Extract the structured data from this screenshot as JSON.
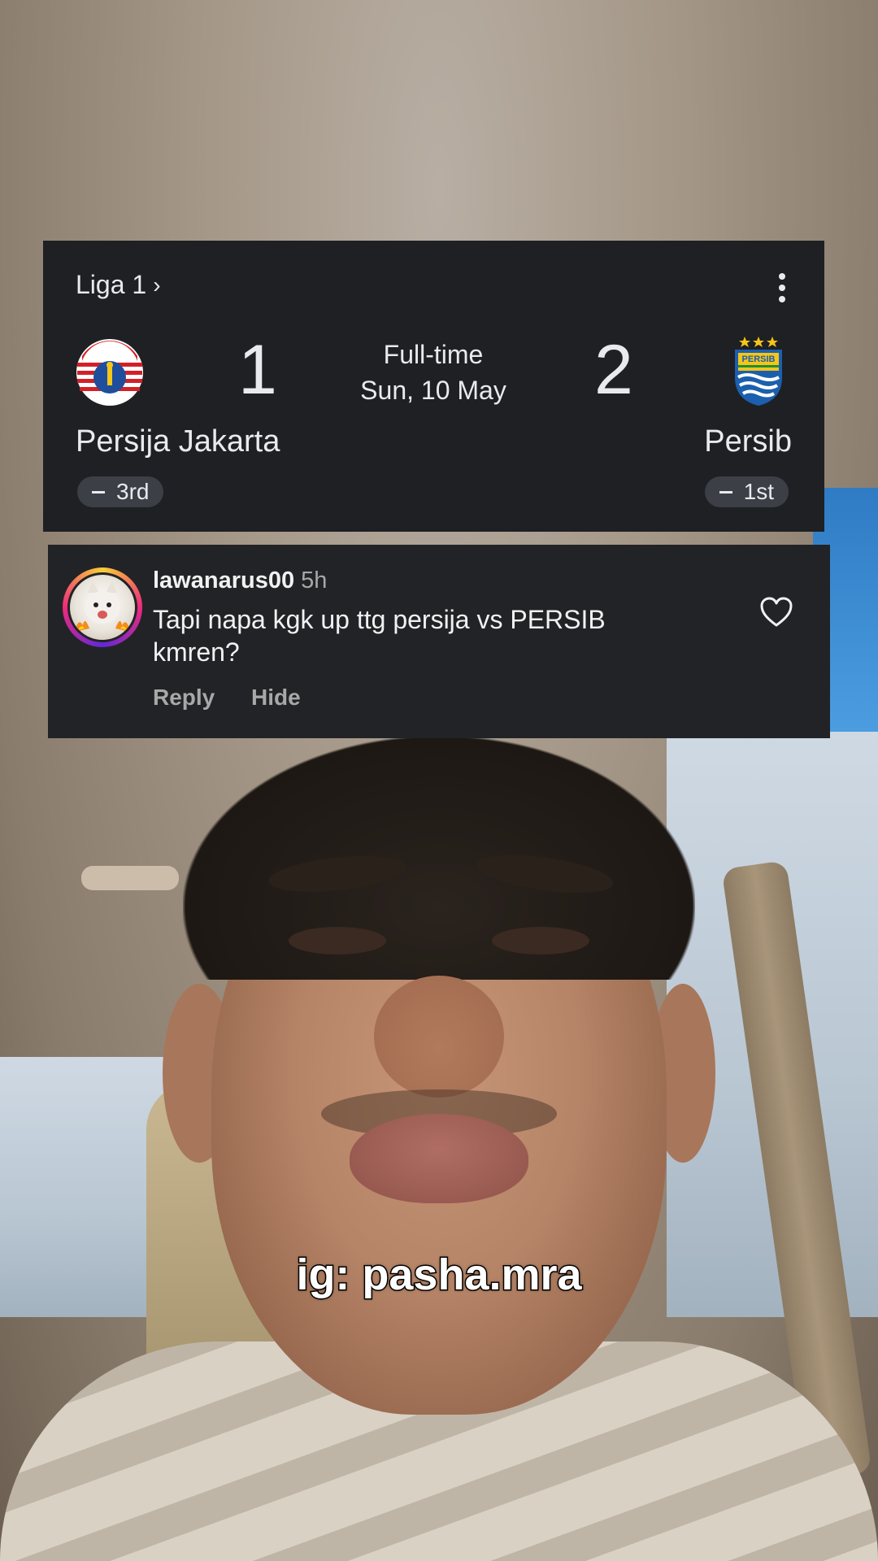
{
  "score_card": {
    "league": "Liga 1",
    "league_chevron": "›",
    "more_icon": "more-vertical-icon",
    "home": {
      "name": "Persija Jakarta",
      "score": "1",
      "rank": "3rd",
      "logo_text": "PERSIJA"
    },
    "away": {
      "name": "Persib",
      "score": "2",
      "rank": "1st",
      "logo_text": "PERSIB"
    },
    "status": "Full-time",
    "date": "Sun, 10 May"
  },
  "comment": {
    "username": "lawanarus00",
    "time": "5h",
    "text": "Tapi napa kgk up ttg persija vs PERSIB kmren?",
    "reply_label": "Reply",
    "hide_label": "Hide",
    "like_icon": "heart-outline-icon"
  },
  "caption": "ig: pasha.mra",
  "colors": {
    "card_bg": "#1f2024",
    "comment_bg": "#222327",
    "text": "#e8eaed",
    "muted": "#a8a8a8"
  }
}
